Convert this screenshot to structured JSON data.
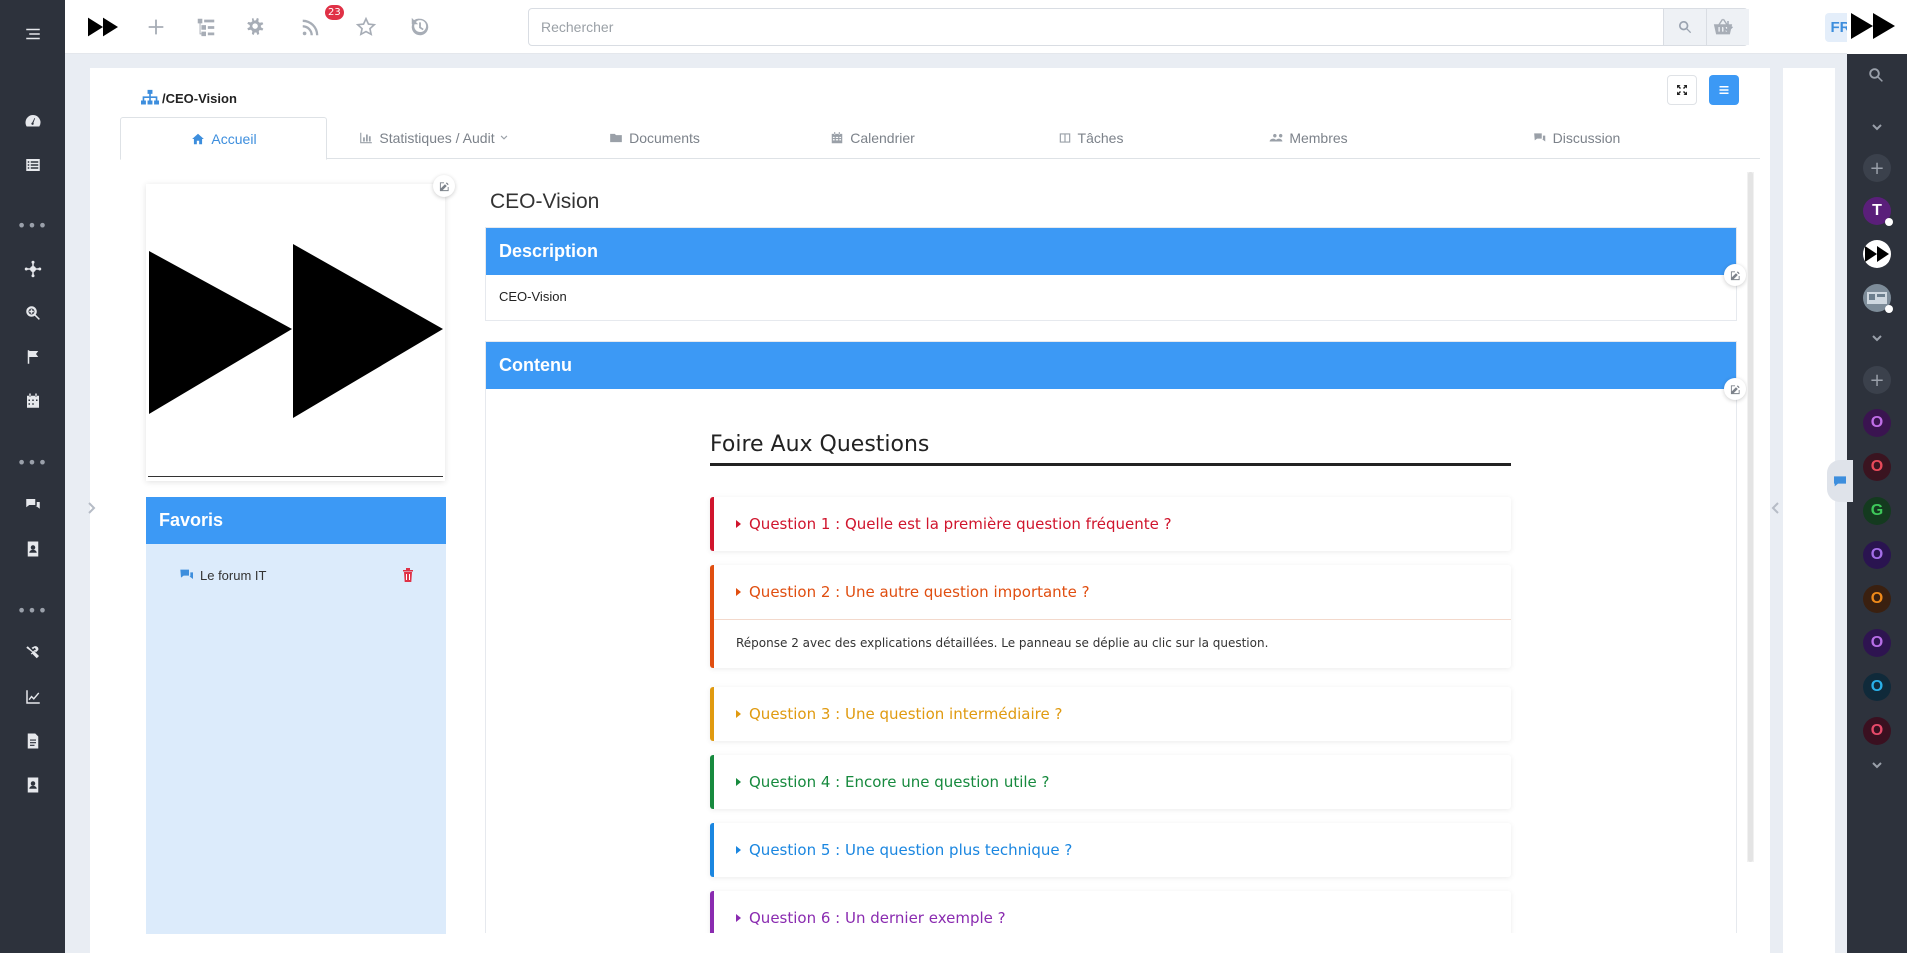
{
  "topbar": {
    "notifications_count": "23",
    "search_placeholder": "Rechercher",
    "language": "FR"
  },
  "breadcrumb": {
    "separator": "/",
    "current": "CEO-Vision"
  },
  "tabs": [
    {
      "label": "Accueil",
      "icon": "home-icon"
    },
    {
      "label": "Statistiques / Audit",
      "icon": "bar-chart-icon"
    },
    {
      "label": "Documents",
      "icon": "folder-icon"
    },
    {
      "label": "Calendrier",
      "icon": "calendar-icon"
    },
    {
      "label": "Tâches",
      "icon": "tasks-icon"
    },
    {
      "label": "Membres",
      "icon": "members-icon"
    },
    {
      "label": "Discussion",
      "icon": "comments-icon"
    }
  ],
  "page": {
    "title": "CEO-Vision"
  },
  "description": {
    "heading": "Description",
    "text": "CEO-Vision"
  },
  "contenu": {
    "heading": "Contenu"
  },
  "favoris": {
    "heading": "Favoris",
    "items": [
      {
        "label": "Le forum IT",
        "icon": "comments-icon"
      }
    ]
  },
  "faq": {
    "title": "Foire Aux Questions",
    "items": [
      {
        "question": "Question 1 : Quelle est la première question fréquente ?",
        "color": "#d0152d",
        "expanded": false
      },
      {
        "question": "Question 2 : Une autre question importante ?",
        "color": "#e04e10",
        "expanded": true,
        "answer": "Réponse 2 avec des explications détaillées. Le panneau se déplie au clic sur la question."
      },
      {
        "question": "Question 3 : Une question intermédiaire ?",
        "color": "#e09a10",
        "expanded": false
      },
      {
        "question": "Question 4 : Encore une question utile ?",
        "color": "#178a3e",
        "expanded": false
      },
      {
        "question": "Question 5 : Une question plus technique ?",
        "color": "#1a86e0",
        "expanded": false
      },
      {
        "question": "Question 6 : Un dernier exemple ?",
        "color": "#8a2bb0",
        "expanded": false
      }
    ]
  },
  "right_sidebar": {
    "avatars": [
      {
        "letter": "T",
        "bg": "#5a1f7a",
        "fg": "#ffffff"
      },
      {
        "letter": "O",
        "bg": "#3a1450",
        "fg": "#c06ee8"
      },
      {
        "letter": "O",
        "bg": "#3a1420",
        "fg": "#e84a5a"
      },
      {
        "letter": "G",
        "bg": "#143a1f",
        "fg": "#3ec85a"
      },
      {
        "letter": "O",
        "bg": "#2a1450",
        "fg": "#a46ee8"
      },
      {
        "letter": "O",
        "bg": "#3a2010",
        "fg": "#f08a1a"
      },
      {
        "letter": "O",
        "bg": "#2e1450",
        "fg": "#b86ee8"
      },
      {
        "letter": "O",
        "bg": "#102a3a",
        "fg": "#2ab0e8"
      },
      {
        "letter": "O",
        "bg": "#3a1020",
        "fg": "#e84a6a"
      }
    ]
  },
  "colors": {
    "accent": "#3c99f5",
    "sidebar": "#2d323c"
  }
}
